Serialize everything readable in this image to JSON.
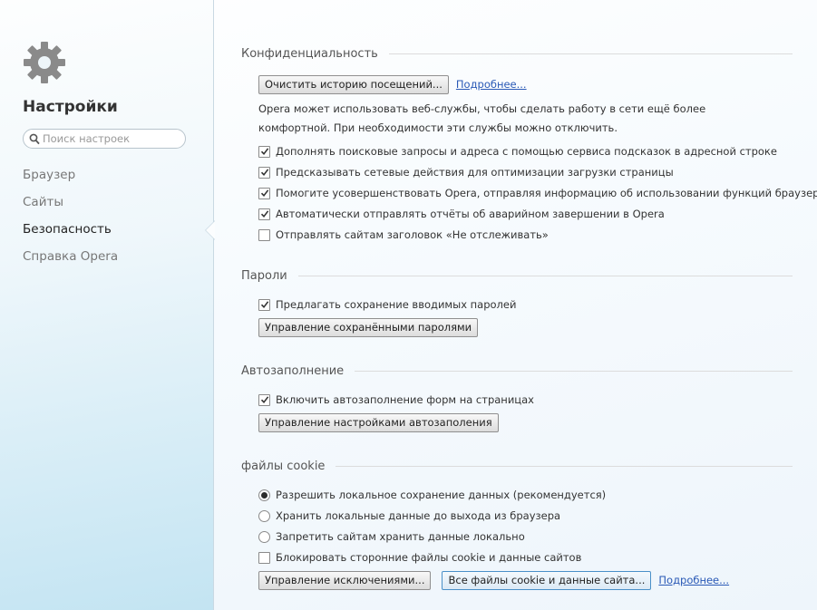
{
  "sidebar": {
    "title": "Настройки",
    "search_placeholder": "Поиск настроек",
    "items": [
      {
        "label": "Браузер"
      },
      {
        "label": "Сайты"
      },
      {
        "label": "Безопасность",
        "active": true
      },
      {
        "label": "Справка Opera"
      }
    ]
  },
  "privacy": {
    "title": "Конфиденциальность",
    "clear_button": "Очистить историю посещений...",
    "more_link": "Подробнее...",
    "description": "Opera может использовать веб-службы, чтобы сделать работу в сети ещё более комфортной. При необходимости эти службы можно отключить.",
    "options": [
      {
        "label": "Дополнять поисковые запросы и адреса с помощью сервиса подсказок в адресной строке",
        "checked": true
      },
      {
        "label": "Предсказывать сетевые действия для оптимизации загрузки страницы",
        "checked": true
      },
      {
        "label": "Помогите усовершенствовать Opera, отправляя информацию об использовании функций браузера",
        "checked": true
      },
      {
        "label": "Автоматически отправлять отчёты об аварийном завершении в Opera",
        "checked": true
      },
      {
        "label": "Отправлять сайтам заголовок «Не отслеживать»",
        "checked": false
      }
    ]
  },
  "passwords": {
    "title": "Пароли",
    "offer_save": {
      "label": "Предлагать сохранение вводимых паролей",
      "checked": true
    },
    "manage_button": "Управление сохранёнными паролями"
  },
  "autofill": {
    "title": "Автозаполнение",
    "enable": {
      "label": "Включить автозаполнение форм на страницах",
      "checked": true
    },
    "manage_button": "Управление настройками автозаполения"
  },
  "cookies": {
    "title": "файлы cookie",
    "options": [
      {
        "label": "Разрешить локальное сохранение данных (рекомендуется)",
        "selected": true
      },
      {
        "label": "Хранить локальные данные до выхода из браузера",
        "selected": false
      },
      {
        "label": "Запретить сайтам хранить данные локально",
        "selected": false
      }
    ],
    "block_third_party": {
      "label": "Блокировать сторонние файлы cookie и данные сайтов",
      "checked": false
    },
    "exceptions_button": "Управление исключениями...",
    "all_cookies_button": "Все файлы cookie и данные сайта...",
    "more_link": "Подробнее..."
  },
  "icons": {
    "settings": "gear-icon",
    "search": "search-icon",
    "check": "checkmark-icon"
  },
  "colors": {
    "link": "#2a59b6",
    "gear": "#8a8a8a"
  }
}
